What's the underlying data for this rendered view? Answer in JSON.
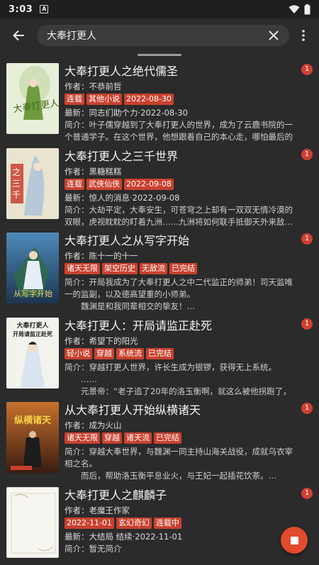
{
  "status_bar": {
    "time": "3:03",
    "notification_letter": "A"
  },
  "toolbar": {
    "search_value": "大奉打更人"
  },
  "colors": {
    "accent": "#c9412f",
    "badge": "#d23f31",
    "fab": "#e24a2c"
  },
  "results": [
    {
      "title": "大奉打更人之绝代儒圣",
      "author": "作者：不恭前哲",
      "tags": [
        "连载",
        "其他小说",
        "2022-08-30"
      ],
      "latest": "最新：同志们助个力·2022-08-30",
      "intro": "简介：叶子儒穿越到了大奉打更人的世界，成为了云鹿书院的一个普通学子。在这个世界，他想跟着自己的本心走，哪怕最后的结…",
      "intro_more": "",
      "badge": "1"
    },
    {
      "title": "大奉打更人之三千世界",
      "author": "作者：黑糖糕糕",
      "tags": [
        "连载",
        "武侠仙侠",
        "2022-09-08"
      ],
      "latest": "最新：惊人的消息·2022-09-08",
      "intro": "简介：大劫平定，大奉安生，可苍穹之上却有一双双无情冷漠的双眼，虎视眈眈的盯着九洲……九洲将如何联手抵御天外来敌…",
      "intro_more": "",
      "badge": "1"
    },
    {
      "title": "大奉打更人之从写字开始",
      "author": "作者：陈十一的十一",
      "tags": [
        "诸天无限",
        "架空历史",
        "无敌流",
        "已完结"
      ],
      "latest": "",
      "intro": "简介：开局我成为了大奉打更人之中二代监正的师弟！司天监唯一的监副，以及德高望重的小师弟。",
      "intro_more": "　　魏渊是和我同辈相交的挚友！…",
      "badge": "1"
    },
    {
      "title": "大奉打更人：开局请监正赴死",
      "author": "作者：希望下的阳光",
      "tags": [
        "轻小说",
        "穿越",
        "系统流",
        "已完结"
      ],
      "latest": "",
      "intro": "简介：穿越打更人世界，许长生成为银锣，获得无上系统。",
      "intro_more": "　　……\n　　元景帝：“老子追了20年的洛玉衡啊，就这么被他拐跑了，老…",
      "badge": "1"
    },
    {
      "title": "从大奉打更人开始纵横诸天",
      "author": "作者：成为火山",
      "tags": [
        "诸天无限",
        "穿越",
        "诸天流",
        "已完结"
      ],
      "latest": "",
      "intro": "简介：穿越大奉世界，与魏渊一同主持山海关战役，成就乌衣宰相之名。",
      "intro_more": "　　而后，帮助洛玉衡平息业火，与王妃一起插花饮茶。…",
      "badge": "1"
    },
    {
      "title": "大奉打更人之麒麟子",
      "author": "作者：老魔王作家",
      "tags": [
        "2022-11-01",
        "玄幻奇幻",
        "连载中"
      ],
      "latest": "最新：大结局 结续·2022-11-01",
      "intro": "简介：暂无简介",
      "intro_more": "",
      "badge": "1"
    }
  ],
  "covers": [
    {
      "text": "大奉打更人",
      "bg": "#e8efd9"
    },
    {
      "text": "之三千世界",
      "bg": "#e9e4cf"
    },
    {
      "text": "从写字开始",
      "bg": "#2c4a6b"
    },
    {
      "text": "大奉打更人\n开局请监正赴死",
      "bg": "#f4f2ec"
    },
    {
      "text": "纵横诸天",
      "bg": "#6b3a1f"
    },
    {
      "text": "",
      "bg": "#f7f5f0"
    }
  ]
}
